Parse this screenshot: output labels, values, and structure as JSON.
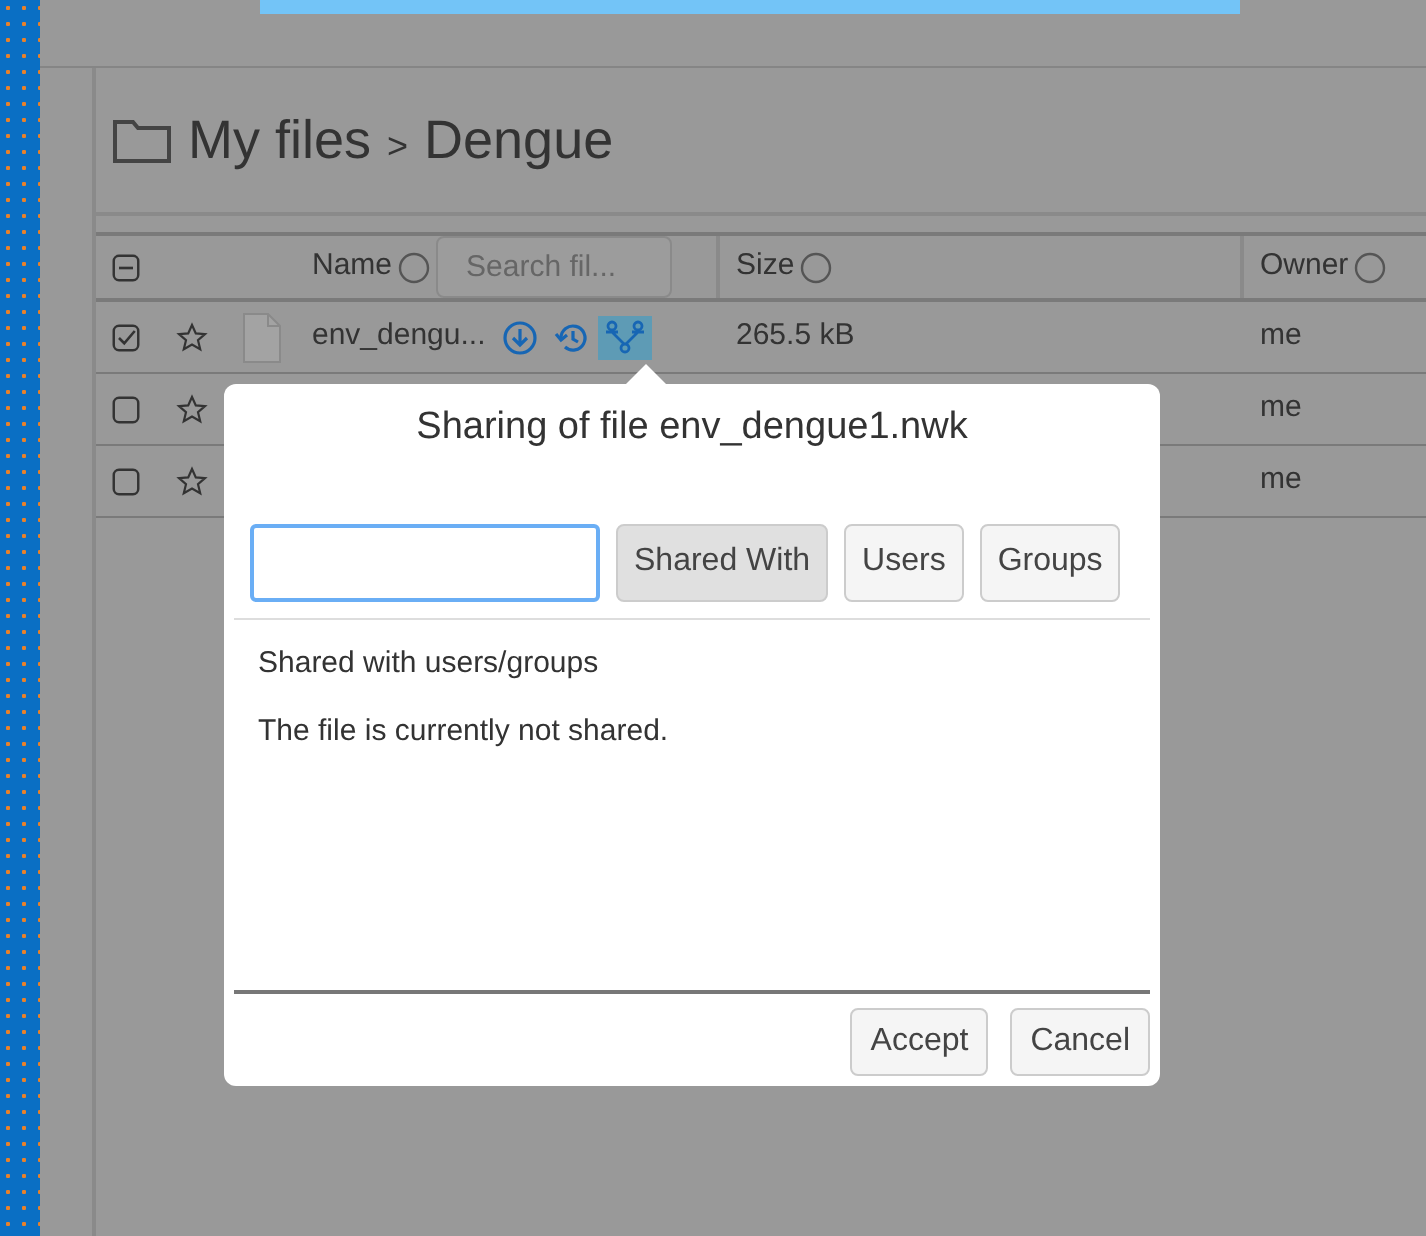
{
  "breadcrumb": {
    "root": "My files",
    "separator": ">",
    "current": "Dengue"
  },
  "table": {
    "search_placeholder": "Search fil...",
    "columns": [
      {
        "label": "Name"
      },
      {
        "label": "Size"
      },
      {
        "label": "Owner"
      }
    ],
    "header_checkbox": {
      "indeterminate": true
    },
    "rows": [
      {
        "checked": true,
        "name": "env_dengu...",
        "size": "265.5 kB",
        "owner": "me"
      },
      {
        "checked": false,
        "owner": "me"
      },
      {
        "checked": false,
        "owner": "me"
      }
    ]
  },
  "dialog": {
    "title": "Sharing of file env_dengue1.nwk",
    "tabs": [
      {
        "label": "Shared With",
        "selected": true
      },
      {
        "label": "Users",
        "selected": false
      },
      {
        "label": "Groups",
        "selected": false
      }
    ],
    "section_title": "Shared with users/groups",
    "message": "The file is currently not shared.",
    "buttons": [
      "Accept",
      "Cancel"
    ]
  }
}
